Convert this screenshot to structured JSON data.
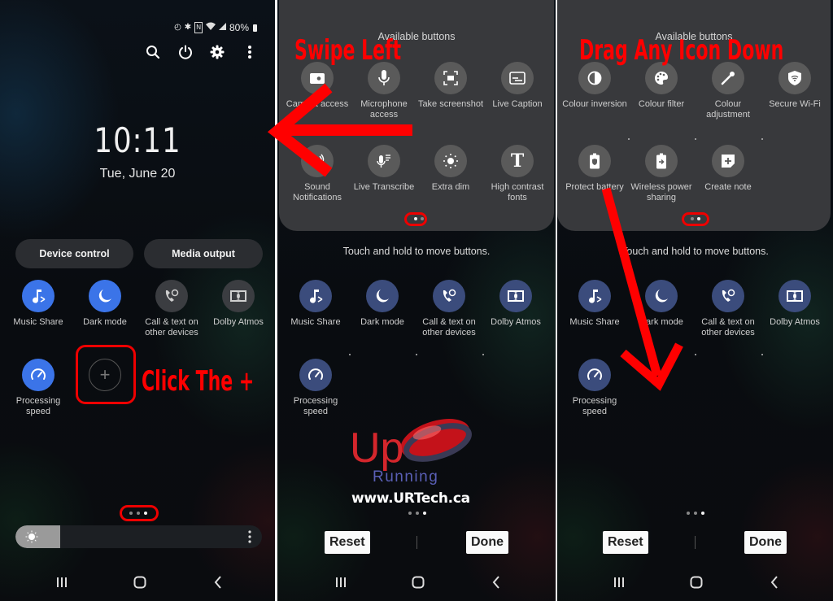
{
  "panel1": {
    "status_bar": {
      "icons": [
        "data-saver-icon",
        "bluetooth-icon",
        "nfc-icon",
        "wifi-icon",
        "signal-icon"
      ],
      "battery_text": "80%"
    },
    "top_actions": [
      "search-icon",
      "power-icon",
      "gear-icon",
      "more-vert-icon"
    ],
    "clock": "10:11",
    "date": "Tue, June 20",
    "pills": [
      {
        "label": "Device control"
      },
      {
        "label": "Media output"
      }
    ],
    "tiles": [
      {
        "label": "Music Share",
        "icon": "music-share-icon",
        "state": "on"
      },
      {
        "label": "Dark mode",
        "icon": "moon-icon",
        "state": "on"
      },
      {
        "label": "Call & text on other devices",
        "icon": "call-sync-icon",
        "state": "off"
      },
      {
        "label": "Dolby Atmos",
        "icon": "dolby-icon",
        "state": "off"
      },
      {
        "label": "Processing speed",
        "icon": "speedometer-icon",
        "state": "on"
      }
    ],
    "add_button": "+",
    "page_indicator": {
      "count": 3,
      "active": 3
    },
    "brightness": {
      "level_percent": 18
    },
    "annotation": "Click The +"
  },
  "panel2": {
    "sheet_title": "Available buttons",
    "available": [
      {
        "label": "Camera access",
        "icon": "camera-icon"
      },
      {
        "label": "Microphone access",
        "icon": "microphone-icon"
      },
      {
        "label": "Take screenshot",
        "icon": "screenshot-icon"
      },
      {
        "label": "Live Caption",
        "icon": "caption-icon"
      },
      {
        "label": "Sound Notifications",
        "icon": "sound-notification-icon"
      },
      {
        "label": "Live Transcribe",
        "icon": "transcribe-icon"
      },
      {
        "label": "Extra dim",
        "icon": "extra-dim-icon"
      },
      {
        "label": "High contrast fonts",
        "icon": "text-t-icon"
      }
    ],
    "sheet_pages": {
      "count": 2,
      "active": 1
    },
    "hint": "Touch and hold to move buttons.",
    "active_tiles": [
      {
        "label": "Music Share"
      },
      {
        "label": "Dark mode"
      },
      {
        "label": "Call & text on other devices"
      },
      {
        "label": "Dolby Atmos"
      },
      {
        "label": "Processing speed"
      }
    ],
    "page_indicator": {
      "count": 3,
      "active": 3
    },
    "reset_label": "Reset",
    "done_label": "Done",
    "annotation": "Swipe Left",
    "watermark": {
      "up": "Up",
      "running": "Running",
      "url": "www.URTech.ca"
    }
  },
  "panel3": {
    "sheet_title": "Available buttons",
    "available": [
      {
        "label": "Colour inversion",
        "icon": "contrast-icon"
      },
      {
        "label": "Colour filter",
        "icon": "palette-icon"
      },
      {
        "label": "Colour adjustment",
        "icon": "eyedropper-icon"
      },
      {
        "label": "Secure Wi-Fi",
        "icon": "shield-wifi-icon"
      },
      {
        "label": "Protect battery",
        "icon": "battery-shield-icon"
      },
      {
        "label": "Wireless power sharing",
        "icon": "power-share-icon"
      },
      {
        "label": "Create note",
        "icon": "note-add-icon"
      }
    ],
    "sheet_pages": {
      "count": 2,
      "active": 2
    },
    "hint": "Touch and hold to move buttons.",
    "active_tiles": [
      {
        "label": "Music Share"
      },
      {
        "label": "Dark mode"
      },
      {
        "label": "Call & text on other devices"
      },
      {
        "label": "Dolby Atmos"
      },
      {
        "label": "Processing speed"
      }
    ],
    "page_indicator": {
      "count": 3,
      "active": 3
    },
    "reset_label": "Reset",
    "done_label": "Done",
    "annotation": "Drag Any Icon Down"
  },
  "nav": [
    "recents-icon",
    "home-icon",
    "back-icon"
  ],
  "colors": {
    "accent_on": "#3b74e8",
    "tile_off": "#3b3d41",
    "edit_tile": "#3b4c7c",
    "annotation": "#ff0000"
  }
}
